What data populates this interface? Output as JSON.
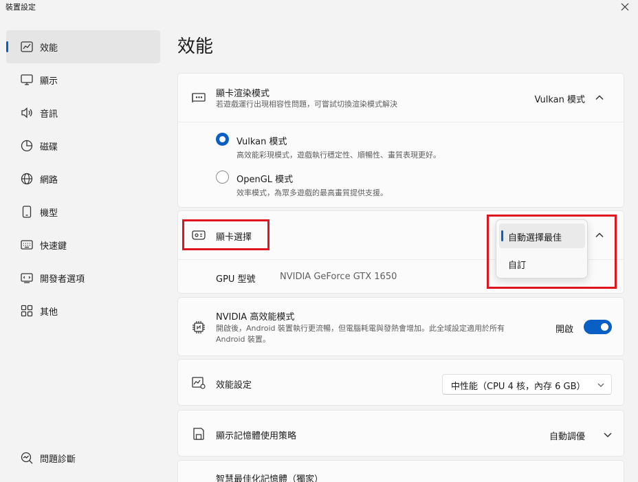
{
  "window": {
    "title": "裝置設定"
  },
  "sidebar": {
    "items": [
      {
        "label": "效能",
        "icon": "performance-chart-icon"
      },
      {
        "label": "顯示",
        "icon": "monitor-icon"
      },
      {
        "label": "音訊",
        "icon": "speaker-icon"
      },
      {
        "label": "磁碟",
        "icon": "pie-disk-icon"
      },
      {
        "label": "網路",
        "icon": "globe-icon"
      },
      {
        "label": "機型",
        "icon": "phone-icon"
      },
      {
        "label": "快速鍵",
        "icon": "keyboard-icon"
      },
      {
        "label": "開發者選項",
        "icon": "dev-tools-icon"
      },
      {
        "label": "其他",
        "icon": "grid-icon"
      }
    ],
    "diagnose_label": "問題診斷"
  },
  "main": {
    "title": "效能",
    "render_mode": {
      "title": "顯卡渲染模式",
      "subtitle": "若遊戲運行出現相容性問題，可嘗試切換渲染模式解決",
      "current": "Vulkan 模式",
      "options": [
        {
          "label": "Vulkan 模式",
          "desc": "高效能彩現模式，遊戲執行穩定性、順暢性、畫質表現更好。",
          "selected": true
        },
        {
          "label": "OpenGL 模式",
          "desc": "效率模式，為眾多遊戲的最高畫質提供支援。",
          "selected": false
        }
      ]
    },
    "gpu_select": {
      "title": "顯卡選擇",
      "gpu_label": "GPU 型號",
      "gpu_value": "NVIDIA GeForce GTX 1650",
      "dropdown_options": [
        "自動選擇最佳",
        "自訂"
      ]
    },
    "nvidia_mode": {
      "title": "NVIDIA 高效能模式",
      "subtitle_line1": "開啟後，Android 裝置執行更流暢，但電腦耗電與發熱會增加。此全域設定適用於所有",
      "subtitle_line2": "Android 裝置。",
      "toggle_label": "開啟",
      "enabled": true
    },
    "perf_setting": {
      "title": "效能設定",
      "value": "中性能（CPU 4 核，內存 6 GB）"
    },
    "memory_policy": {
      "title": "顯示記憶體使用策略",
      "value": "自動調優"
    },
    "smart_memory": {
      "title": "智慧最佳化記憶體（獨家）"
    }
  },
  "colors": {
    "accent": "#0a5fc4",
    "highlight": "#e0141e"
  }
}
